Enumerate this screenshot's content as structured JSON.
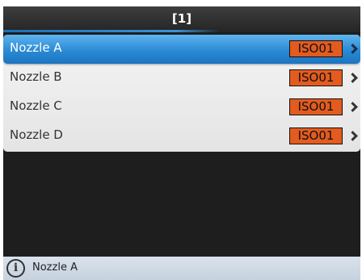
{
  "header": {
    "title": "[1]"
  },
  "nozzles": [
    {
      "name": "Nozzle A",
      "badge": "ISO01",
      "selected": true
    },
    {
      "name": "Nozzle B",
      "badge": "ISO01",
      "selected": false
    },
    {
      "name": "Nozzle C",
      "badge": "ISO01",
      "selected": false
    },
    {
      "name": "Nozzle D",
      "badge": "ISO01",
      "selected": false
    }
  ],
  "status": {
    "icon": "info-icon",
    "text": "Nozzle A"
  },
  "colors": {
    "selection": "#2a8ad4",
    "badge_background": "#e35b1f",
    "status_bar": "#d9e2ec"
  }
}
